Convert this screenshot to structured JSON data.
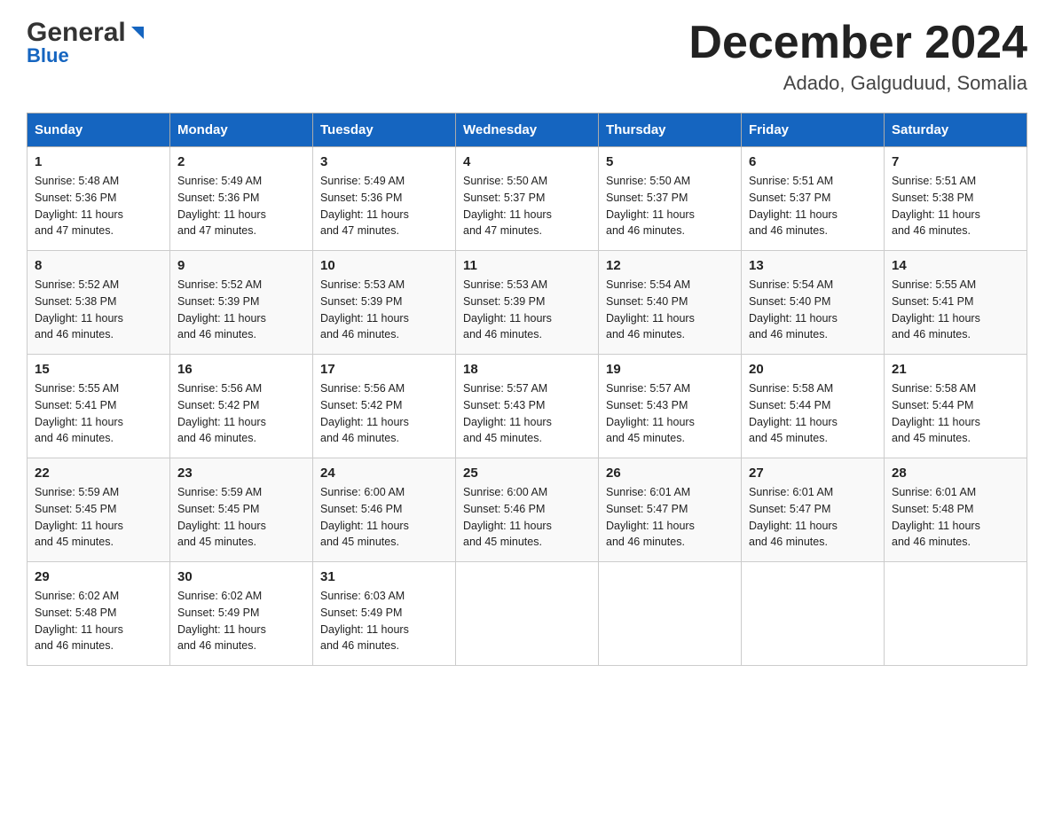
{
  "logo": {
    "general": "General",
    "blue": "Blue"
  },
  "title": {
    "month_year": "December 2024",
    "location": "Adado, Galguduud, Somalia"
  },
  "days_of_week": [
    "Sunday",
    "Monday",
    "Tuesday",
    "Wednesday",
    "Thursday",
    "Friday",
    "Saturday"
  ],
  "weeks": [
    [
      {
        "day": "1",
        "sunrise": "5:48 AM",
        "sunset": "5:36 PM",
        "daylight": "11 hours and 47 minutes."
      },
      {
        "day": "2",
        "sunrise": "5:49 AM",
        "sunset": "5:36 PM",
        "daylight": "11 hours and 47 minutes."
      },
      {
        "day": "3",
        "sunrise": "5:49 AM",
        "sunset": "5:36 PM",
        "daylight": "11 hours and 47 minutes."
      },
      {
        "day": "4",
        "sunrise": "5:50 AM",
        "sunset": "5:37 PM",
        "daylight": "11 hours and 47 minutes."
      },
      {
        "day": "5",
        "sunrise": "5:50 AM",
        "sunset": "5:37 PM",
        "daylight": "11 hours and 46 minutes."
      },
      {
        "day": "6",
        "sunrise": "5:51 AM",
        "sunset": "5:37 PM",
        "daylight": "11 hours and 46 minutes."
      },
      {
        "day": "7",
        "sunrise": "5:51 AM",
        "sunset": "5:38 PM",
        "daylight": "11 hours and 46 minutes."
      }
    ],
    [
      {
        "day": "8",
        "sunrise": "5:52 AM",
        "sunset": "5:38 PM",
        "daylight": "11 hours and 46 minutes."
      },
      {
        "day": "9",
        "sunrise": "5:52 AM",
        "sunset": "5:39 PM",
        "daylight": "11 hours and 46 minutes."
      },
      {
        "day": "10",
        "sunrise": "5:53 AM",
        "sunset": "5:39 PM",
        "daylight": "11 hours and 46 minutes."
      },
      {
        "day": "11",
        "sunrise": "5:53 AM",
        "sunset": "5:39 PM",
        "daylight": "11 hours and 46 minutes."
      },
      {
        "day": "12",
        "sunrise": "5:54 AM",
        "sunset": "5:40 PM",
        "daylight": "11 hours and 46 minutes."
      },
      {
        "day": "13",
        "sunrise": "5:54 AM",
        "sunset": "5:40 PM",
        "daylight": "11 hours and 46 minutes."
      },
      {
        "day": "14",
        "sunrise": "5:55 AM",
        "sunset": "5:41 PM",
        "daylight": "11 hours and 46 minutes."
      }
    ],
    [
      {
        "day": "15",
        "sunrise": "5:55 AM",
        "sunset": "5:41 PM",
        "daylight": "11 hours and 46 minutes."
      },
      {
        "day": "16",
        "sunrise": "5:56 AM",
        "sunset": "5:42 PM",
        "daylight": "11 hours and 46 minutes."
      },
      {
        "day": "17",
        "sunrise": "5:56 AM",
        "sunset": "5:42 PM",
        "daylight": "11 hours and 46 minutes."
      },
      {
        "day": "18",
        "sunrise": "5:57 AM",
        "sunset": "5:43 PM",
        "daylight": "11 hours and 45 minutes."
      },
      {
        "day": "19",
        "sunrise": "5:57 AM",
        "sunset": "5:43 PM",
        "daylight": "11 hours and 45 minutes."
      },
      {
        "day": "20",
        "sunrise": "5:58 AM",
        "sunset": "5:44 PM",
        "daylight": "11 hours and 45 minutes."
      },
      {
        "day": "21",
        "sunrise": "5:58 AM",
        "sunset": "5:44 PM",
        "daylight": "11 hours and 45 minutes."
      }
    ],
    [
      {
        "day": "22",
        "sunrise": "5:59 AM",
        "sunset": "5:45 PM",
        "daylight": "11 hours and 45 minutes."
      },
      {
        "day": "23",
        "sunrise": "5:59 AM",
        "sunset": "5:45 PM",
        "daylight": "11 hours and 45 minutes."
      },
      {
        "day": "24",
        "sunrise": "6:00 AM",
        "sunset": "5:46 PM",
        "daylight": "11 hours and 45 minutes."
      },
      {
        "day": "25",
        "sunrise": "6:00 AM",
        "sunset": "5:46 PM",
        "daylight": "11 hours and 45 minutes."
      },
      {
        "day": "26",
        "sunrise": "6:01 AM",
        "sunset": "5:47 PM",
        "daylight": "11 hours and 46 minutes."
      },
      {
        "day": "27",
        "sunrise": "6:01 AM",
        "sunset": "5:47 PM",
        "daylight": "11 hours and 46 minutes."
      },
      {
        "day": "28",
        "sunrise": "6:01 AM",
        "sunset": "5:48 PM",
        "daylight": "11 hours and 46 minutes."
      }
    ],
    [
      {
        "day": "29",
        "sunrise": "6:02 AM",
        "sunset": "5:48 PM",
        "daylight": "11 hours and 46 minutes."
      },
      {
        "day": "30",
        "sunrise": "6:02 AM",
        "sunset": "5:49 PM",
        "daylight": "11 hours and 46 minutes."
      },
      {
        "day": "31",
        "sunrise": "6:03 AM",
        "sunset": "5:49 PM",
        "daylight": "11 hours and 46 minutes."
      },
      null,
      null,
      null,
      null
    ]
  ],
  "labels": {
    "sunrise": "Sunrise:",
    "sunset": "Sunset:",
    "daylight": "Daylight:"
  }
}
